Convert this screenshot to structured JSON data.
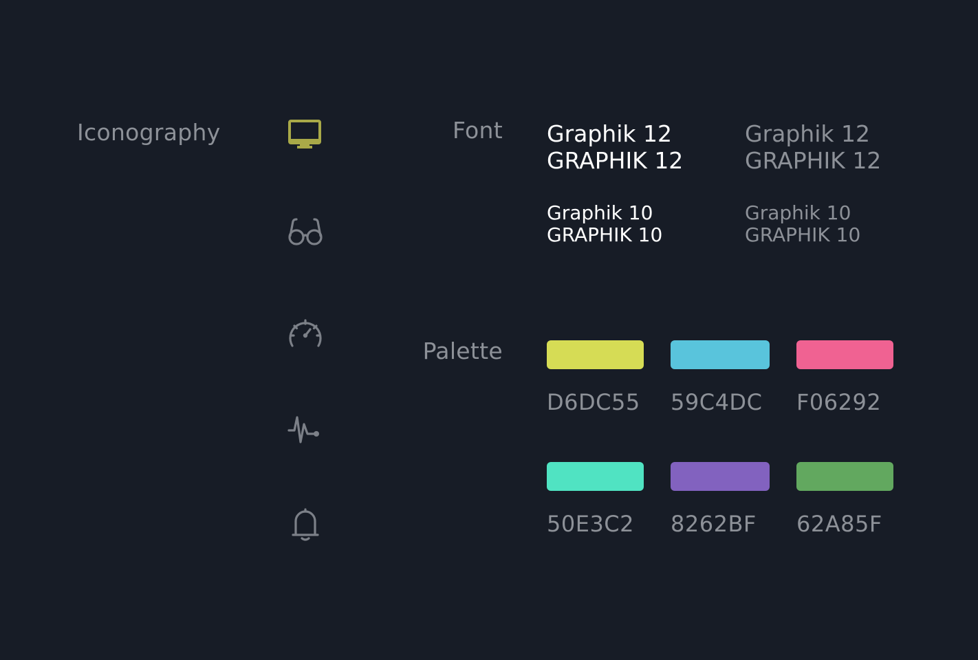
{
  "sections": {
    "iconography": "Iconography",
    "font": "Font",
    "palette": "Palette"
  },
  "icons": [
    {
      "name": "monitor-icon",
      "color": "#a9a948"
    },
    {
      "name": "glasses-icon",
      "color": "#7c8088"
    },
    {
      "name": "speedometer-icon",
      "color": "#7c8088"
    },
    {
      "name": "pulse-icon",
      "color": "#7c8088"
    },
    {
      "name": "bell-icon",
      "color": "#7c8088"
    }
  ],
  "font_samples": {
    "white_12": {
      "line1": "Graphik 12",
      "line2": "GRAPHIK 12"
    },
    "grey_12": {
      "line1": "Graphik 12",
      "line2": "GRAPHIK 12"
    },
    "white_10": {
      "line1": "Graphik 10",
      "line2": "GRAPHIK 10"
    },
    "grey_10": {
      "line1": "Graphik 10",
      "line2": "GRAPHIK 10"
    }
  },
  "palette": [
    {
      "hex": "D6DC55",
      "color": "#D6DC55"
    },
    {
      "hex": "59C4DC",
      "color": "#59C4DC"
    },
    {
      "hex": "F06292",
      "color": "#F06292"
    },
    {
      "hex": "50E3C2",
      "color": "#50E3C2"
    },
    {
      "hex": "8262BF",
      "color": "#8262BF"
    },
    {
      "hex": "62A85F",
      "color": "#62A85F"
    }
  ]
}
